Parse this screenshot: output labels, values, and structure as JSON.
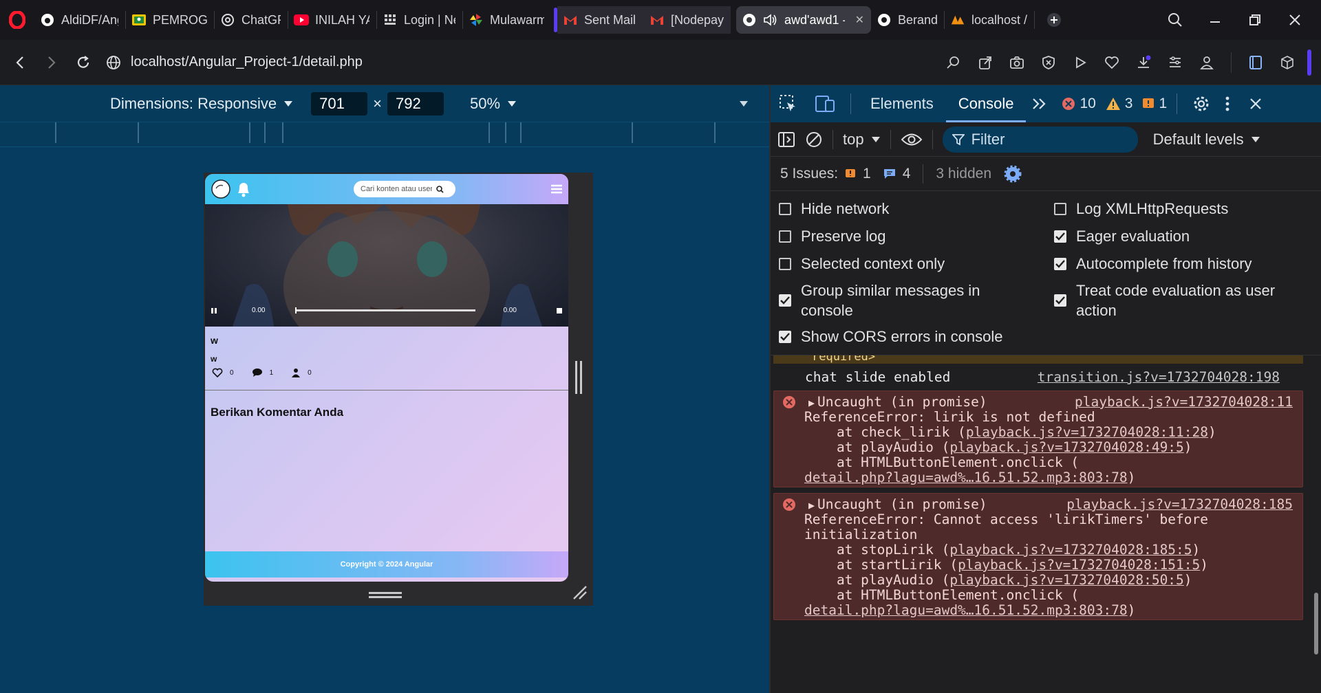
{
  "tabs": [
    {
      "label": "AldiDF/Ang",
      "icon": "github-icon"
    },
    {
      "label": "PEMROGRA",
      "icon": "classroom-icon"
    },
    {
      "label": "ChatGPT",
      "icon": "chatgpt-icon"
    },
    {
      "label": "INILAH YA",
      "icon": "youtube-icon"
    },
    {
      "label": "Login | Ne",
      "icon": "grid-icon"
    },
    {
      "label": "Mulawarm",
      "icon": "pinwheel-icon"
    },
    {
      "label": "Sent Mail -",
      "icon": "gmail-icon"
    },
    {
      "label": "[Nodepay]",
      "icon": "gmail-icon"
    },
    {
      "label": "awd'awd1 -",
      "icon": "record-icon"
    },
    {
      "label": "Beranda",
      "icon": "record-icon"
    },
    {
      "label": "localhost /",
      "icon": "phpmyadmin-icon"
    }
  ],
  "address": {
    "url": "localhost/Angular_Project-1/detail.php"
  },
  "device_toolbar": {
    "dimensions_label": "Dimensions: Responsive",
    "width": "701",
    "times": "×",
    "height": "792",
    "zoom": "50%"
  },
  "webpage": {
    "search_placeholder": "Cari konten atau user",
    "time_start": "0.00",
    "time_end": "0.00",
    "song_title": "w",
    "song_artist": "w",
    "likes": "0",
    "comments": "1",
    "listeners": "0",
    "comment_heading": "Berikan Komentar Anda",
    "footer": "Copyright © 2024 Angular"
  },
  "devtools": {
    "tab_elements": "Elements",
    "tab_console": "Console",
    "errors": "10",
    "warnings": "3",
    "issues_badge": "1",
    "context": "top",
    "filter": "Filter",
    "levels": "Default levels",
    "issues_label": "5 Issues:",
    "issues_warn": "1",
    "issues_info": "4",
    "hidden": "3 hidden",
    "settings": [
      {
        "label": "Hide network",
        "checked": false
      },
      {
        "label": "Log XMLHttpRequests",
        "checked": false
      },
      {
        "label": "Preserve log",
        "checked": false
      },
      {
        "label": "Eager evaluation",
        "checked": true
      },
      {
        "label": "Selected context only",
        "checked": false
      },
      {
        "label": "Autocomplete from history",
        "checked": true
      },
      {
        "label": "Group similar messages in console",
        "checked": true
      },
      {
        "label": "Treat code evaluation as user action",
        "checked": true
      },
      {
        "label": "Show CORS errors in console",
        "checked": true
      }
    ],
    "partial_text": "required>",
    "log1_text": "chat slide enabled",
    "log1_link": "transition.js?v=1732704028:198",
    "err1": {
      "title": "Uncaught (in promise)",
      "link": "playback.js?v=1732704028:11",
      "message": "ReferenceError: lirik is not defined",
      "stack": [
        {
          "at": "    at check_lirik (",
          "link": "playback.js?v=1732704028:11:28",
          "end": ")"
        },
        {
          "at": "    at playAudio (",
          "link": "playback.js?v=1732704028:49:5",
          "end": ")"
        },
        {
          "at": "    at HTMLButtonElement.onclick (",
          "link": "",
          "end": ""
        },
        {
          "at": "",
          "link": "detail.php?lagu=awd%…16.51.52.mp3:803:78",
          "end": ")"
        }
      ]
    },
    "err2": {
      "title": "Uncaught (in promise)",
      "link": "playback.js?v=1732704028:185",
      "message": "ReferenceError: Cannot access 'lirikTimers' before",
      "message2": "initialization",
      "stack": [
        {
          "at": "    at stopLirik (",
          "link": "playback.js?v=1732704028:185:5",
          "end": ")"
        },
        {
          "at": "    at startLirik (",
          "link": "playback.js?v=1732704028:151:5",
          "end": ")"
        },
        {
          "at": "    at playAudio (",
          "link": "playback.js?v=1732704028:50:5",
          "end": ")"
        },
        {
          "at": "    at HTMLButtonElement.onclick (",
          "link": "",
          "end": ""
        },
        {
          "at": "",
          "link": "detail.php?lagu=awd%…16.51.52.mp3:803:78",
          "end": ")"
        }
      ]
    }
  }
}
